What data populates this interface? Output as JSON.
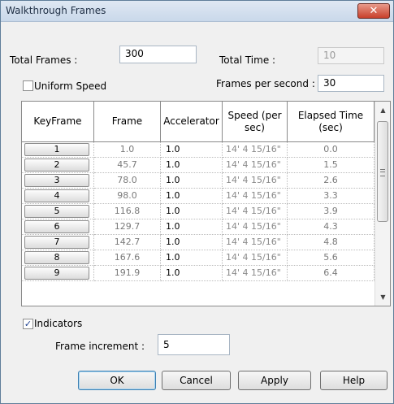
{
  "window": {
    "title": "Walkthrough Frames",
    "close_glyph": "✕"
  },
  "fields": {
    "total_frames_label": "Total Frames :",
    "total_frames_value": "300",
    "total_time_label": "Total Time :",
    "total_time_value": "10",
    "uniform_speed_label": "Uniform Speed",
    "uniform_speed_checked": false,
    "fps_label": "Frames per second :",
    "fps_value": "30"
  },
  "table": {
    "columns": [
      "KeyFrame",
      "Frame",
      "Accelerator",
      "Speed (per sec)",
      "Elapsed Time (sec)"
    ],
    "rows": [
      {
        "keyframe": "1",
        "frame": "1.0",
        "accelerator": "1.0",
        "speed": "14'  4 15/16\"",
        "elapsed": "0.0"
      },
      {
        "keyframe": "2",
        "frame": "45.7",
        "accelerator": "1.0",
        "speed": "14'  4 15/16\"",
        "elapsed": "1.5"
      },
      {
        "keyframe": "3",
        "frame": "78.0",
        "accelerator": "1.0",
        "speed": "14'  4 15/16\"",
        "elapsed": "2.6"
      },
      {
        "keyframe": "4",
        "frame": "98.0",
        "accelerator": "1.0",
        "speed": "14'  4 15/16\"",
        "elapsed": "3.3"
      },
      {
        "keyframe": "5",
        "frame": "116.8",
        "accelerator": "1.0",
        "speed": "14'  4 15/16\"",
        "elapsed": "3.9"
      },
      {
        "keyframe": "6",
        "frame": "129.7",
        "accelerator": "1.0",
        "speed": "14'  4 15/16\"",
        "elapsed": "4.3"
      },
      {
        "keyframe": "7",
        "frame": "142.7",
        "accelerator": "1.0",
        "speed": "14'  4 15/16\"",
        "elapsed": "4.8"
      },
      {
        "keyframe": "8",
        "frame": "167.6",
        "accelerator": "1.0",
        "speed": "14'  4 15/16\"",
        "elapsed": "5.6"
      },
      {
        "keyframe": "9",
        "frame": "191.9",
        "accelerator": "1.0",
        "speed": "14'  4 15/16\"",
        "elapsed": "6.4"
      }
    ]
  },
  "indicators": {
    "label": "Indicators",
    "checked": true,
    "check_glyph": "✓"
  },
  "frame_increment": {
    "label": "Frame increment :",
    "value": "5"
  },
  "buttons": {
    "ok": "OK",
    "cancel": "Cancel",
    "apply": "Apply",
    "help": "Help"
  },
  "scrollbar": {
    "up_glyph": "▲",
    "down_glyph": "▼"
  }
}
